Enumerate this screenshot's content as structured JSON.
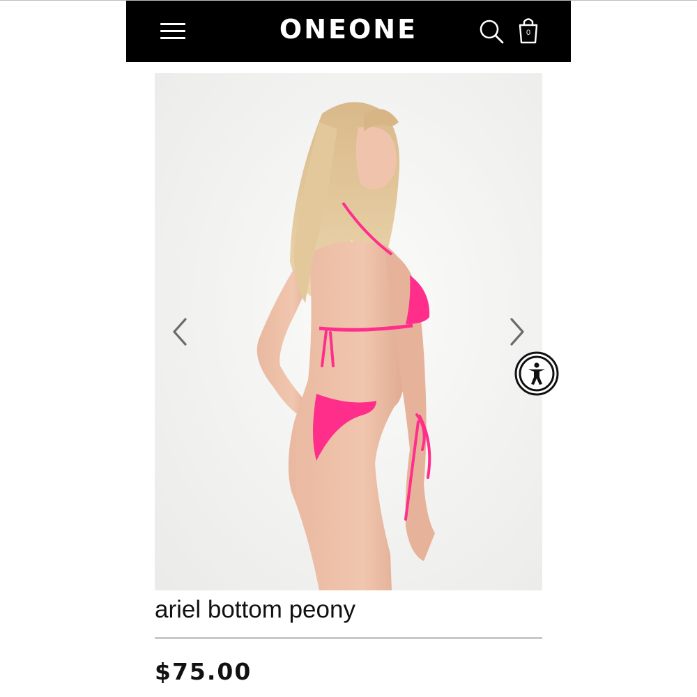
{
  "header": {
    "brand": "ONEONE",
    "menu_icon": "hamburger-menu-icon",
    "search_icon": "search-icon",
    "bag_icon": "shopping-bag-icon",
    "bag_count": "0",
    "background_color": "#000000"
  },
  "gallery": {
    "image": "model wearing pink bikini, rear three-quarter view",
    "prev_icon": "chevron-left-icon",
    "next_icon": "chevron-right-icon"
  },
  "accessibility": {
    "icon": "accessibility-person-icon"
  },
  "product": {
    "title": "ariel bottom peony",
    "price": "$75.00",
    "accent_color": "#ff2e8a"
  }
}
